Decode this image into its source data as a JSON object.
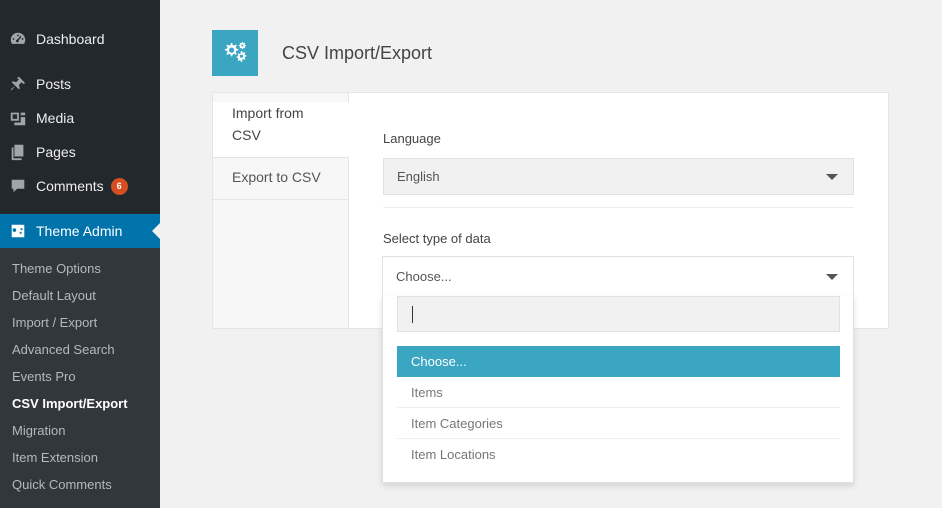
{
  "sidebar": {
    "menu": [
      {
        "label": "Dashboard",
        "icon": "dashboard-icon"
      },
      {
        "label": "Posts",
        "icon": "pin-icon"
      },
      {
        "label": "Media",
        "icon": "media-icon"
      },
      {
        "label": "Pages",
        "icon": "pages-icon"
      },
      {
        "label": "Comments",
        "icon": "comment-icon",
        "badge": "6"
      },
      {
        "label": "Theme Admin",
        "icon": "theme-admin-icon"
      }
    ],
    "submenu": [
      "Theme Options",
      "Default Layout",
      "Import / Export",
      "Advanced Search",
      "Events Pro",
      "CSV Import/Export",
      "Migration",
      "Item Extension",
      "Quick Comments"
    ],
    "current_submenu": "CSV Import/Export"
  },
  "header": {
    "title": "CSV Import/Export",
    "icon": "gears-icon"
  },
  "tabs": [
    {
      "label": "Import from CSV",
      "line1": "Import from",
      "line2": "CSV"
    },
    {
      "label": "Export to CSV"
    }
  ],
  "form": {
    "language": {
      "label": "Language",
      "value": "English"
    },
    "data_type": {
      "label": "Select type of data",
      "value": "Choose..."
    }
  },
  "dropdown": {
    "search_value": "",
    "options": [
      "Choose...",
      "Items",
      "Item Categories",
      "Item Locations"
    ],
    "selected": "Choose..."
  },
  "colors": {
    "accent": "#3ba6c1",
    "sidebar_bg": "#23282d",
    "sidebar_active": "#0073aa",
    "badge": "#d54e21"
  }
}
